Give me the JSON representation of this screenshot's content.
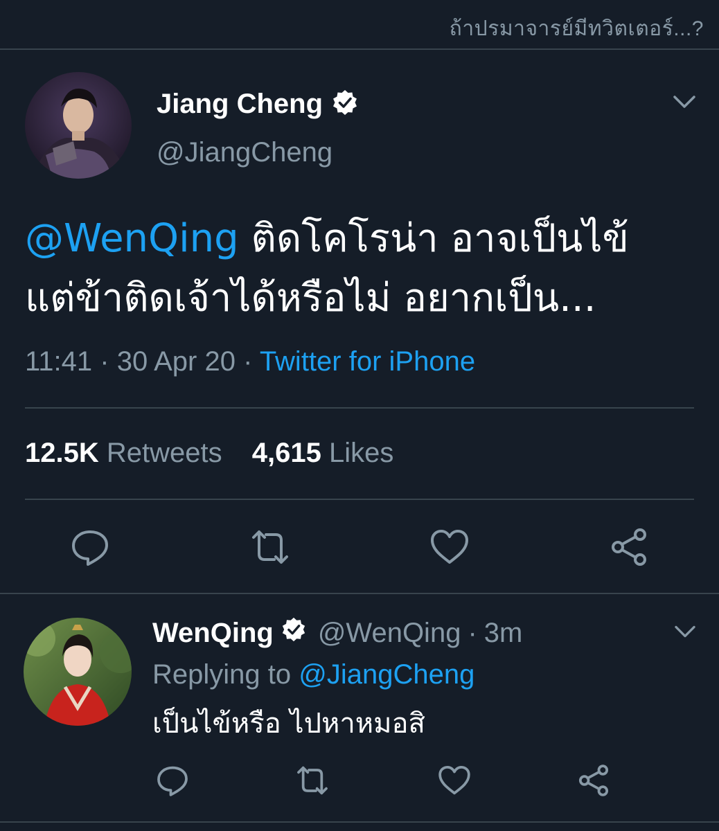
{
  "caption": "ถ้าปรมาจารย์มีทวิตเตอร์...?",
  "main_tweet": {
    "display_name": "Jiang Cheng",
    "handle": "@JiangCheng",
    "mention": "@WenQing",
    "text_line1_rest": " ติดโคโรน่า อาจเป็นไข้",
    "text_line2": "แต่ข้าติดเจ้าได้หรือไม่ อยากเป็น...",
    "time": "11:41",
    "date": "30 Apr 20",
    "separator": "·",
    "source": "Twitter for iPhone",
    "retweets_count": "12.5K",
    "retweets_label": "Retweets",
    "likes_count": "4,615",
    "likes_label": "Likes"
  },
  "reply_tweet": {
    "display_name": "WenQing",
    "handle": "@WenQing",
    "separator": "·",
    "age": "3m",
    "replying_to_label": "Replying to",
    "replying_to_handle": "@JiangCheng",
    "text": "เป็นไข้หรือ ไปหาหมอสิ"
  },
  "icons": {
    "reply": "comment-icon",
    "retweet": "retweet-icon",
    "like": "heart-icon",
    "share": "share-icon",
    "menu": "chevron-down-icon",
    "verified": "verified-badge-icon"
  },
  "colors": {
    "background": "#151d28",
    "accent": "#1da1f2",
    "secondary_text": "#8899a6",
    "divider": "#38444d"
  }
}
